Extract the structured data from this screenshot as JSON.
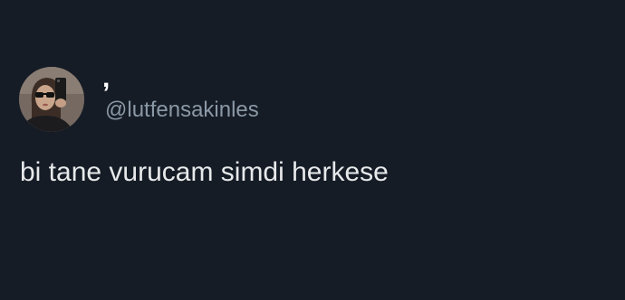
{
  "tweet": {
    "author": {
      "display_name": ",",
      "handle": "@lutfensakinles"
    },
    "text": "bi tane vurucam simdi herkese"
  },
  "colors": {
    "background": "#151c26",
    "text": "#e7e9ea",
    "secondary_text": "#8b98a5"
  }
}
